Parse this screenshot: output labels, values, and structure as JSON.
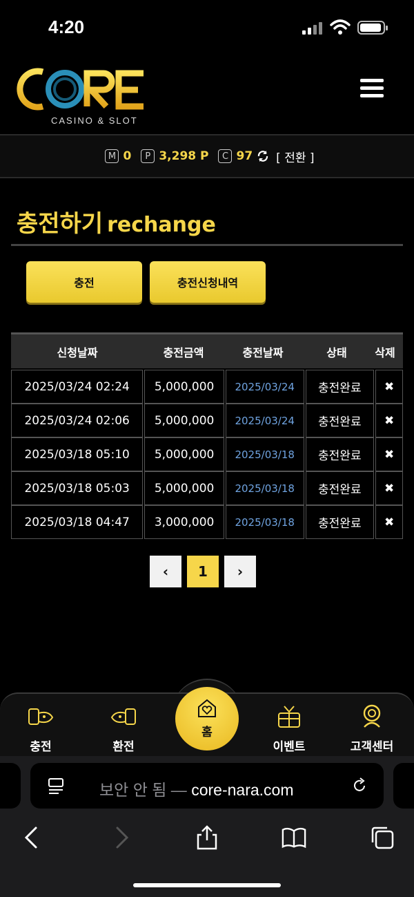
{
  "status": {
    "time": "4:20"
  },
  "header": {
    "logo_text": "CORE",
    "logo_sub": "CASINO & SLOT",
    "menu_icon": "hamburger-menu-icon"
  },
  "balance": {
    "m_label": "M",
    "m_value": "0",
    "p_label": "P",
    "p_value": "3,298 P",
    "c_label": "C",
    "c_value": "97",
    "convert_label": "[ 전환 ]"
  },
  "page": {
    "title_ko": "충전하기",
    "title_en": "rechange"
  },
  "buttons": {
    "charge": "충전",
    "history": "충전신청내역"
  },
  "table": {
    "headers": [
      "신청날짜",
      "충전금액",
      "충전날짜",
      "상태",
      "삭제"
    ],
    "rows": [
      {
        "requested": "2025/03/24 02:24",
        "amount": "5,000,000",
        "date": "2025/03/24",
        "status": "충전완료"
      },
      {
        "requested": "2025/03/24 02:06",
        "amount": "5,000,000",
        "date": "2025/03/24",
        "status": "충전완료"
      },
      {
        "requested": "2025/03/18 05:10",
        "amount": "5,000,000",
        "date": "2025/03/18",
        "status": "충전완료"
      },
      {
        "requested": "2025/03/18 05:03",
        "amount": "5,000,000",
        "date": "2025/03/18",
        "status": "충전완료"
      },
      {
        "requested": "2025/03/18 04:47",
        "amount": "3,000,000",
        "date": "2025/03/18",
        "status": "충전완료"
      }
    ],
    "delete_symbol": "✖"
  },
  "pager": {
    "prev": "‹",
    "current": "1",
    "next": "›"
  },
  "bottom_nav": {
    "charge": "충전",
    "exchange": "환전",
    "home": "홈",
    "event": "이벤트",
    "support": "고객센터"
  },
  "browser": {
    "security": "보안 안 됨 —",
    "domain": "core-nara.com"
  },
  "colors": {
    "accent": "#f6d64a",
    "link": "#6fa3e0",
    "background": "#000000"
  }
}
